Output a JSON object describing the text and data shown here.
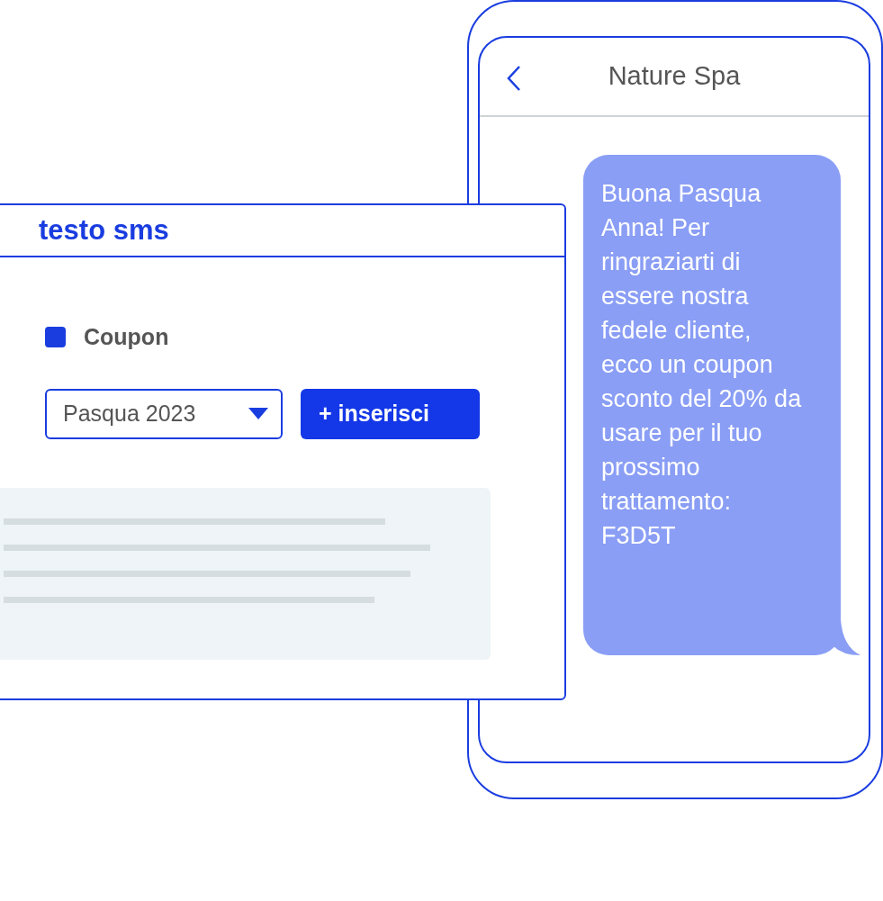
{
  "phone": {
    "title": "Nature Spa",
    "message": "Buona Pasqua Anna! Per ringraziarti di essere nostra fedele cliente, ecco un coupon sconto del 20% da usare per il tuo prossimo trattamento: F3D5T"
  },
  "editor": {
    "title": "testo sms",
    "coupon": {
      "label": "Coupon",
      "checked": true
    },
    "dropdown": {
      "value": "Pasqua 2023"
    },
    "insert_button": "+ inserisci"
  }
}
